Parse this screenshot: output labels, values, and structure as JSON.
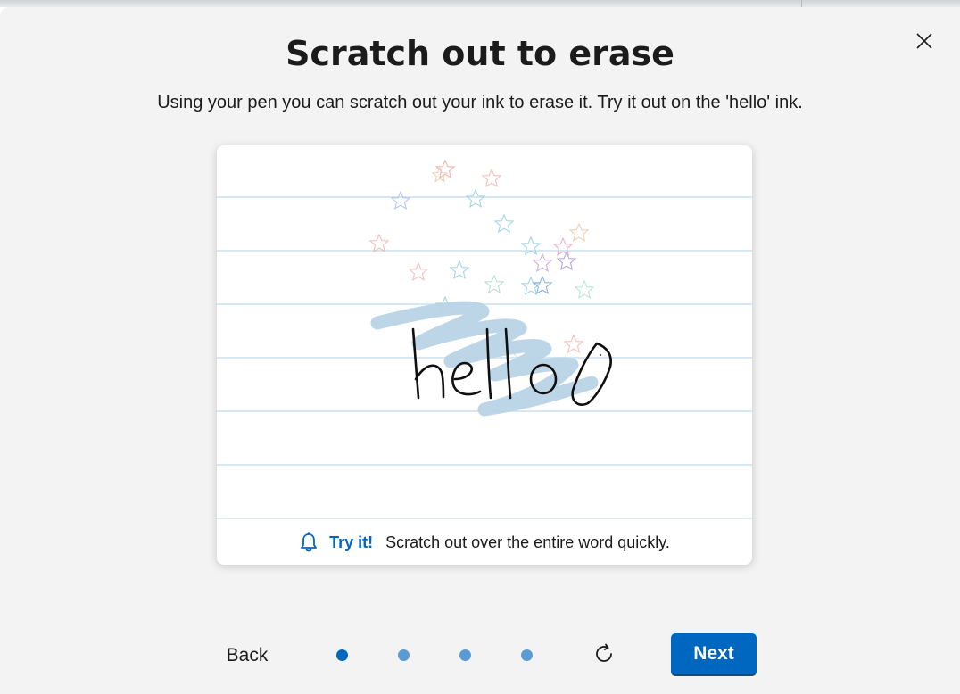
{
  "dialog": {
    "title": "Scratch out to erase",
    "subtitle": "Using your pen you can scratch out your ink to erase it. Try it out on the 'hello' ink."
  },
  "canvas": {
    "ink_word": "hello",
    "tip_icon": "bell-icon",
    "tip_label": "Try it!",
    "tip_text": "Scratch out over the entire word quickly."
  },
  "footer": {
    "back_label": "Back",
    "next_label": "Next",
    "reset_icon": "refresh-icon",
    "steps_total": 4,
    "current_step": 1
  },
  "colors": {
    "accent": "#0067c0",
    "dot_active": "#0067c0",
    "dot_inactive": "#5b9bd5",
    "scribble": "#b9d4e6",
    "ruled_line": "#d7e8f4"
  }
}
